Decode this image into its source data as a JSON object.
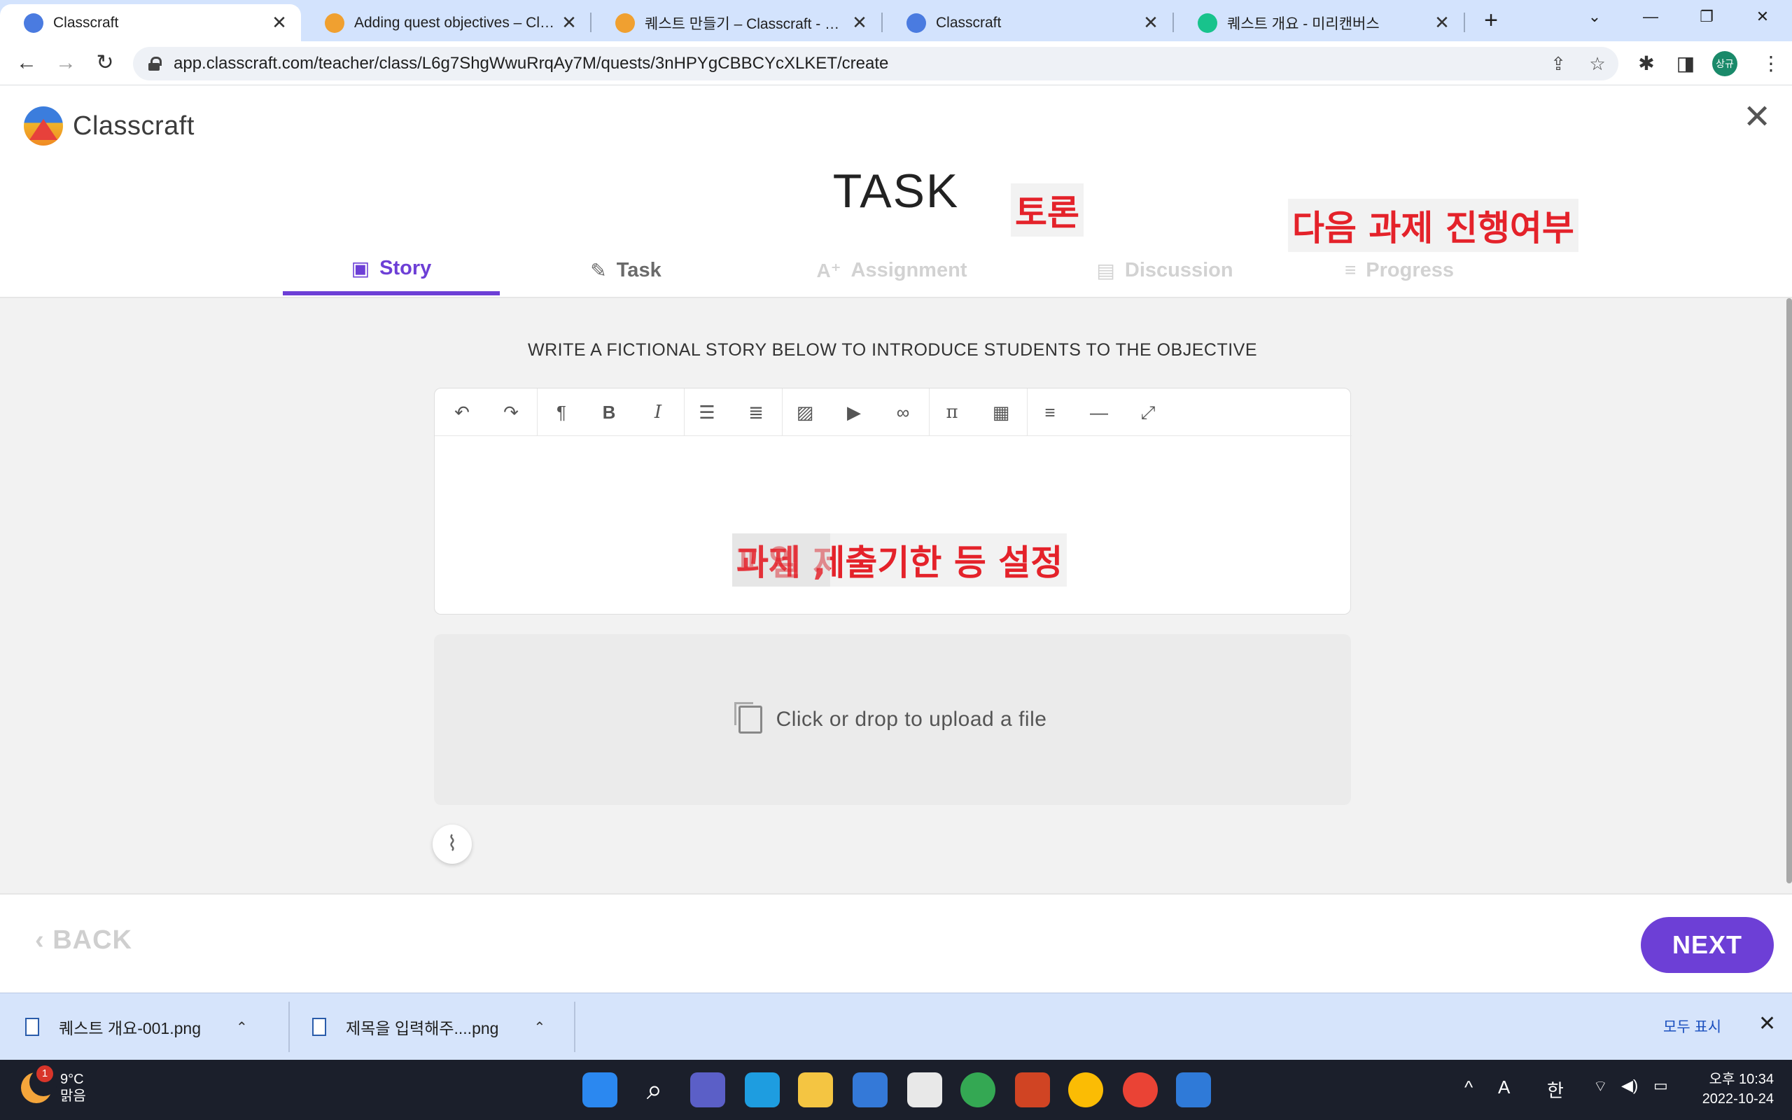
{
  "browser": {
    "tabs": [
      {
        "title": "Classcraft",
        "favicon_color": "#4a7be0"
      },
      {
        "title": "Adding quest objectives – Classcraft",
        "favicon_color": "#f0a030"
      },
      {
        "title": "퀘스트 만들기 – Classcraft - 지원",
        "favicon_color": "#f0a030"
      },
      {
        "title": "Classcraft",
        "favicon_color": "#4a7be0"
      },
      {
        "title": "퀘스트 개요 - 미리캔버스",
        "favicon_color": "#18c38c"
      }
    ],
    "url": "app.classcraft.com/teacher/class/L6g7ShgWwuRrqAy7M/quests/3nHPYgCBBCYcXLKET/create",
    "profile_initials": "상규"
  },
  "app": {
    "logo_text": "Classcraft",
    "page_title": "TASK",
    "steps": [
      {
        "label": "Story",
        "icon": "book-icon",
        "state": "active"
      },
      {
        "label": "Task",
        "icon": "edit-icon",
        "state": "enabled"
      },
      {
        "label": "Assignment",
        "icon": "grade-icon",
        "state": "disabled"
      },
      {
        "label": "Discussion",
        "icon": "chat-icon",
        "state": "disabled"
      },
      {
        "label": "Progress",
        "icon": "checklist-icon",
        "state": "disabled"
      }
    ],
    "instruction": "WRITE A FICTIONAL STORY BELOW TO INTRODUCE STUDENTS TO THE OBJECTIVE",
    "editor_toolbar": [
      "undo-icon",
      "redo-icon",
      "paragraph-icon",
      "bold-icon",
      "italic-icon",
      "bullet-list-icon",
      "numbered-list-icon",
      "image-icon",
      "video-icon",
      "link-icon",
      "math-icon",
      "table-icon",
      "align-icon",
      "horizontal-rule-icon",
      "fullscreen-icon"
    ],
    "upload_text": "Click or drop to upload a file",
    "back_label": "BACK",
    "next_label": "NEXT",
    "accent_color": "#6d3fd6"
  },
  "annotations": {
    "discussion": "토론",
    "progress": "다음 과제 진행여부",
    "overlap_a": "파일 제출기한 등 설정",
    "overlap_b": "과제 ,"
  },
  "downloads": {
    "items": [
      "퀘스트 개요-001.png",
      "제목을 입력해주....png"
    ],
    "show_all": "모두 표시"
  },
  "taskbar": {
    "weather_temp": "9°C",
    "weather_desc": "맑음",
    "weather_badge": "1",
    "ime_a": "A",
    "ime_lang": "한",
    "time": "오후 10:34",
    "date": "2022-10-24"
  }
}
